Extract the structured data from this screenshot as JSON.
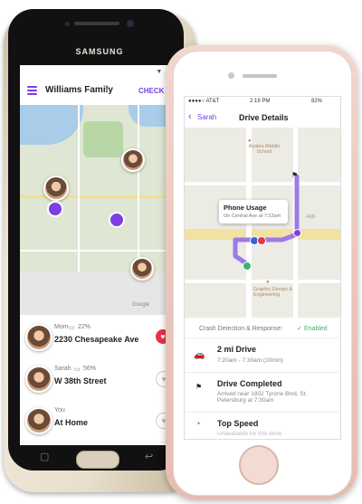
{
  "android": {
    "brand": "SAMSUNG",
    "app_title": "Williams Family",
    "check_in_label": "CHECK IN",
    "members": [
      {
        "name": "Mom",
        "battery": "22%",
        "address": "2230 Chesapeake Ave",
        "heart_active": true
      },
      {
        "name": "Sarah",
        "battery": "56%",
        "address": "W 38th Street",
        "heart_active": false
      },
      {
        "name": "You",
        "battery": "",
        "address": "At Home",
        "heart_active": false
      }
    ],
    "map_watermark": "Google",
    "colors": {
      "accent": "#7b3fe4",
      "heart_red": "#e8334a",
      "map_land": "#dfe6d3",
      "map_water": "#a9cce8"
    }
  },
  "iphone": {
    "status": {
      "carrier": "●●●●○ AT&T",
      "time": "2:19 PM",
      "battery": "82%"
    },
    "nav": {
      "back_label": "Sarah",
      "title": "Drive Details"
    },
    "map": {
      "school_label": "Azalea Middle School",
      "right_label": "Aldi",
      "bottom_label": "Graphic Design & Engineering",
      "tooltip_title": "Phone Usage",
      "tooltip_sub": "On Central Ave at 7:22am"
    },
    "crash": {
      "label": "Crash Detection & Response:",
      "status": "Enabled"
    },
    "rows": [
      {
        "title": "2 mi Drive",
        "sub": "7:20am - 7:30am (10min)"
      },
      {
        "title": "Drive Completed",
        "sub": "Arrived near 1802 Tyrone Blvd, St. Petersburg at 7:30am"
      },
      {
        "title": "Top Speed",
        "sub": "Unavailable for this drive"
      }
    ],
    "colors": {
      "accent": "#7b3fe4",
      "enabled_green": "#3cb371",
      "route": "#9b7be6"
    }
  }
}
